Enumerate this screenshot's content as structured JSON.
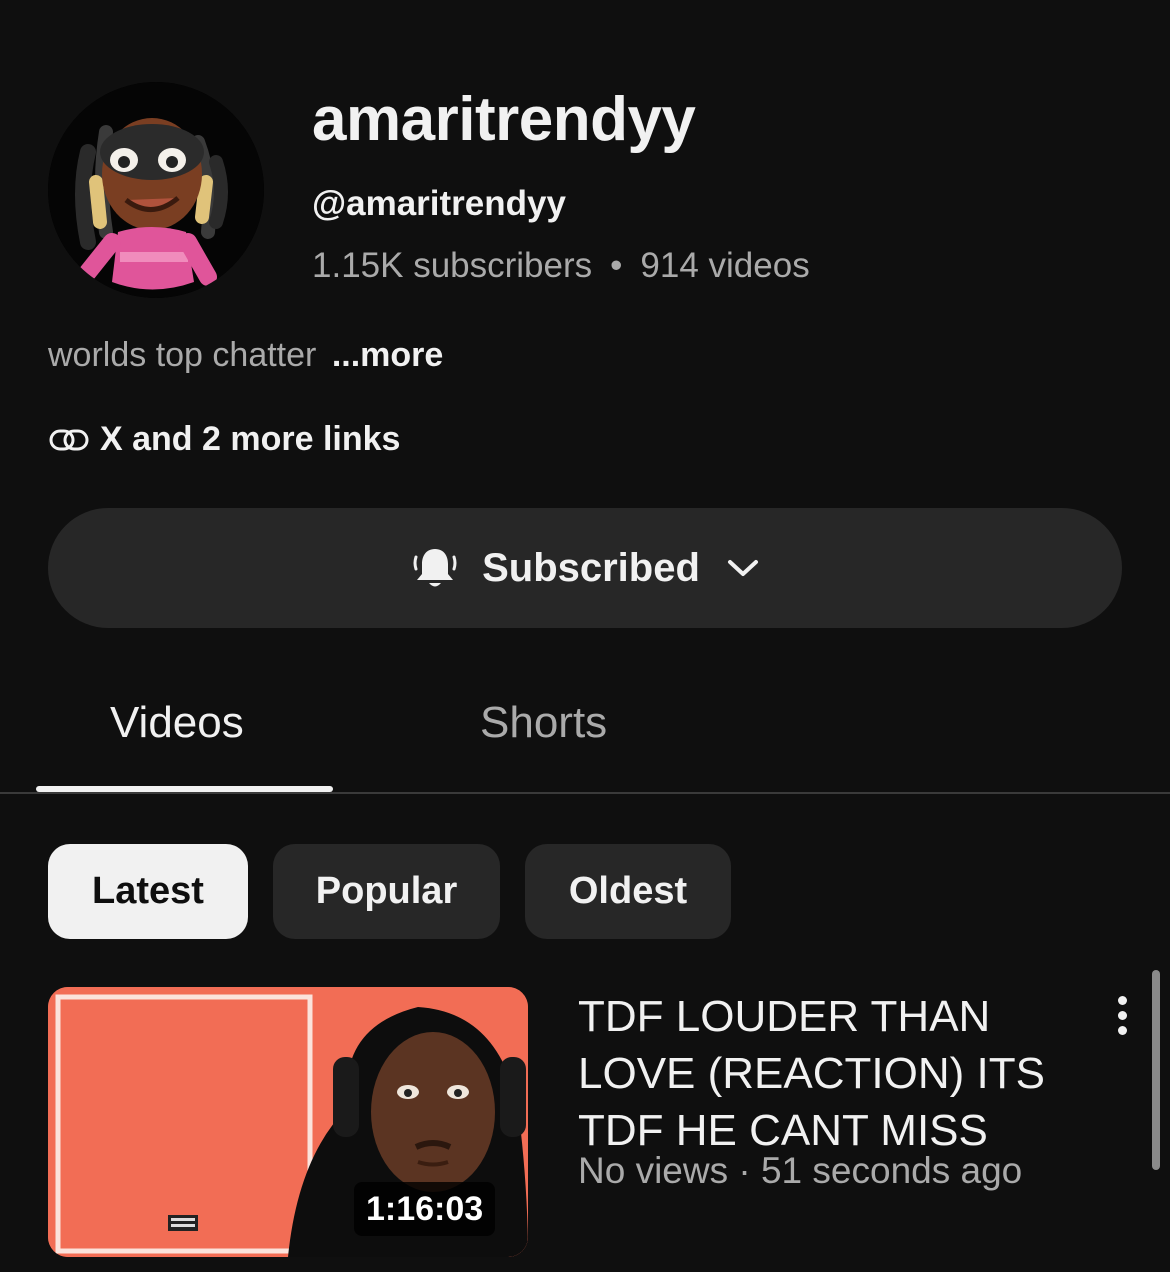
{
  "channel": {
    "name": "amaritrendyy",
    "handle": "@amaritrendyy",
    "subscribers": "1.15K subscribers",
    "separator": "•",
    "videos_count": "914 videos",
    "description": "worlds top chatter",
    "description_more": "...more",
    "links_label": "X and 2 more links"
  },
  "subscribe": {
    "label": "Subscribed",
    "icon": "bell-icon"
  },
  "tabs": [
    {
      "label": "Videos",
      "active": true
    },
    {
      "label": "Shorts",
      "active": false
    }
  ],
  "filters": [
    {
      "label": "Latest",
      "active": true
    },
    {
      "label": "Popular",
      "active": false
    },
    {
      "label": "Oldest",
      "active": false
    }
  ],
  "videos": [
    {
      "title": "TDF LOUDER THAN LOVE (REACTION) ITS TDF HE CANT MISS",
      "meta": "No views · 51 seconds ago",
      "duration": "1:16:03"
    }
  ],
  "colors": {
    "background": "#0f0f0f",
    "surface": "#272727",
    "text_primary": "#f1f1f1",
    "text_secondary": "#aaaaaa",
    "thumbnail_accent": "#f26d55"
  }
}
